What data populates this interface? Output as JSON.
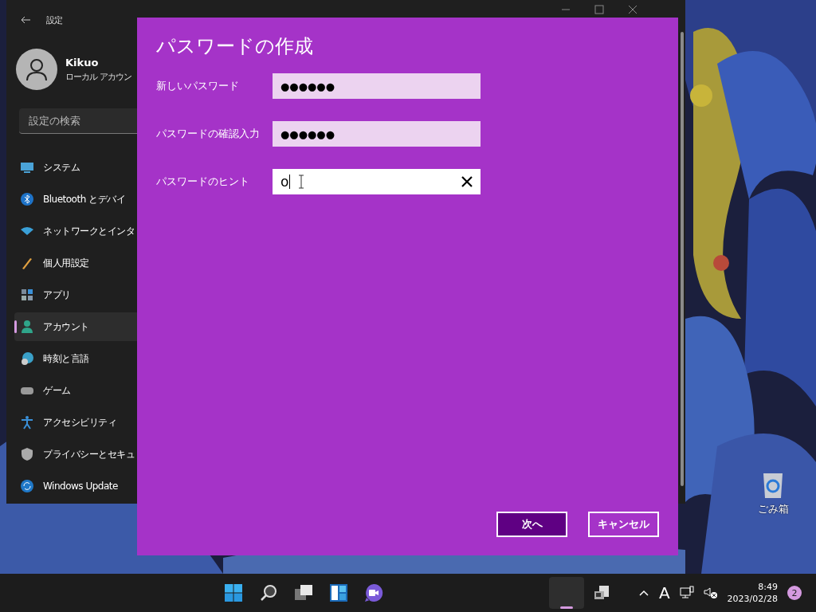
{
  "settings_window": {
    "title": "設定",
    "user": {
      "name": "Kikuo",
      "account": "ローカル アカウン"
    },
    "search": {
      "placeholder": "設定の検索"
    },
    "nav_items": [
      {
        "label": "システム",
        "selected": false
      },
      {
        "label": "Bluetooth とデバイ",
        "selected": false
      },
      {
        "label": "ネットワークとインタ",
        "selected": false
      },
      {
        "label": "個人用設定",
        "selected": false
      },
      {
        "label": "アプリ",
        "selected": false
      },
      {
        "label": "アカウント",
        "selected": true
      },
      {
        "label": "時刻と言語",
        "selected": false
      },
      {
        "label": "ゲーム",
        "selected": false
      },
      {
        "label": "アクセシビリティ",
        "selected": false
      },
      {
        "label": "プライバシーとセキュ",
        "selected": false
      },
      {
        "label": "Windows Update",
        "selected": false
      }
    ]
  },
  "dialog": {
    "title": "パスワードの作成",
    "fields": [
      {
        "label": "新しいパスワード",
        "value": "●●●●●●",
        "focused": false
      },
      {
        "label": "パスワードの確認入力",
        "value": "●●●●●●",
        "focused": false
      },
      {
        "label": "パスワードのヒント",
        "value": "o",
        "focused": true
      }
    ],
    "buttons": [
      {
        "label": "次へ",
        "kind": "primary"
      },
      {
        "label": "キャンセル",
        "kind": "secondary"
      }
    ]
  },
  "desktop_icons": [
    {
      "label": "ごみ箱"
    }
  ],
  "taskbar": {
    "input_indicator": "A",
    "time": "8:49",
    "date": "2023/02/28",
    "notification_count": "2"
  }
}
